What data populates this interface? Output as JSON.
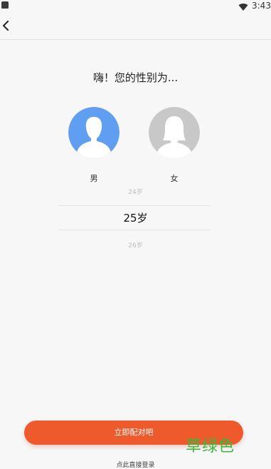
{
  "status_bar": {
    "time": "3:43",
    "icons": [
      "notification-icon",
      "wifi-icon"
    ]
  },
  "nav": {
    "back_icon": "chevron-left-icon"
  },
  "title": "嗨！您的性别为...",
  "gender": {
    "male_label": "男",
    "female_label": "女",
    "selected": "男",
    "male_color": "#5f9ef0",
    "female_color": "#c8c8c8"
  },
  "age_picker": {
    "prev": "24岁",
    "selected": "25岁",
    "next": "26岁"
  },
  "actions": {
    "match_label": "立即配对吧",
    "login_label": "点此直接登录",
    "accent_color": "#ef5a2d"
  },
  "watermark": "草绿色"
}
